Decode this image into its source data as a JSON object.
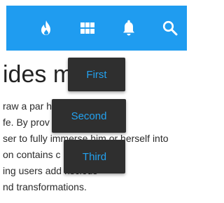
{
  "toolbar": {
    "accent_color": "#1f9cf0",
    "icons": [
      "flame-icon",
      "grid-icon",
      "bell-icon",
      "search-icon"
    ]
  },
  "main": {
    "headline": "ides m       ng",
    "paragraph_lines": [
      "raw a par                       hat they see",
      "fe. By prov                        back and",
      "ser to fully immerse him or herself into",
      "on contains c                  nd",
      "ing users add                       nscious",
      "nd transformations."
    ]
  },
  "menu": {
    "items": [
      "First",
      "Second",
      "Third"
    ],
    "text_color": "#23a2f0",
    "background": "#2f2f2f"
  }
}
